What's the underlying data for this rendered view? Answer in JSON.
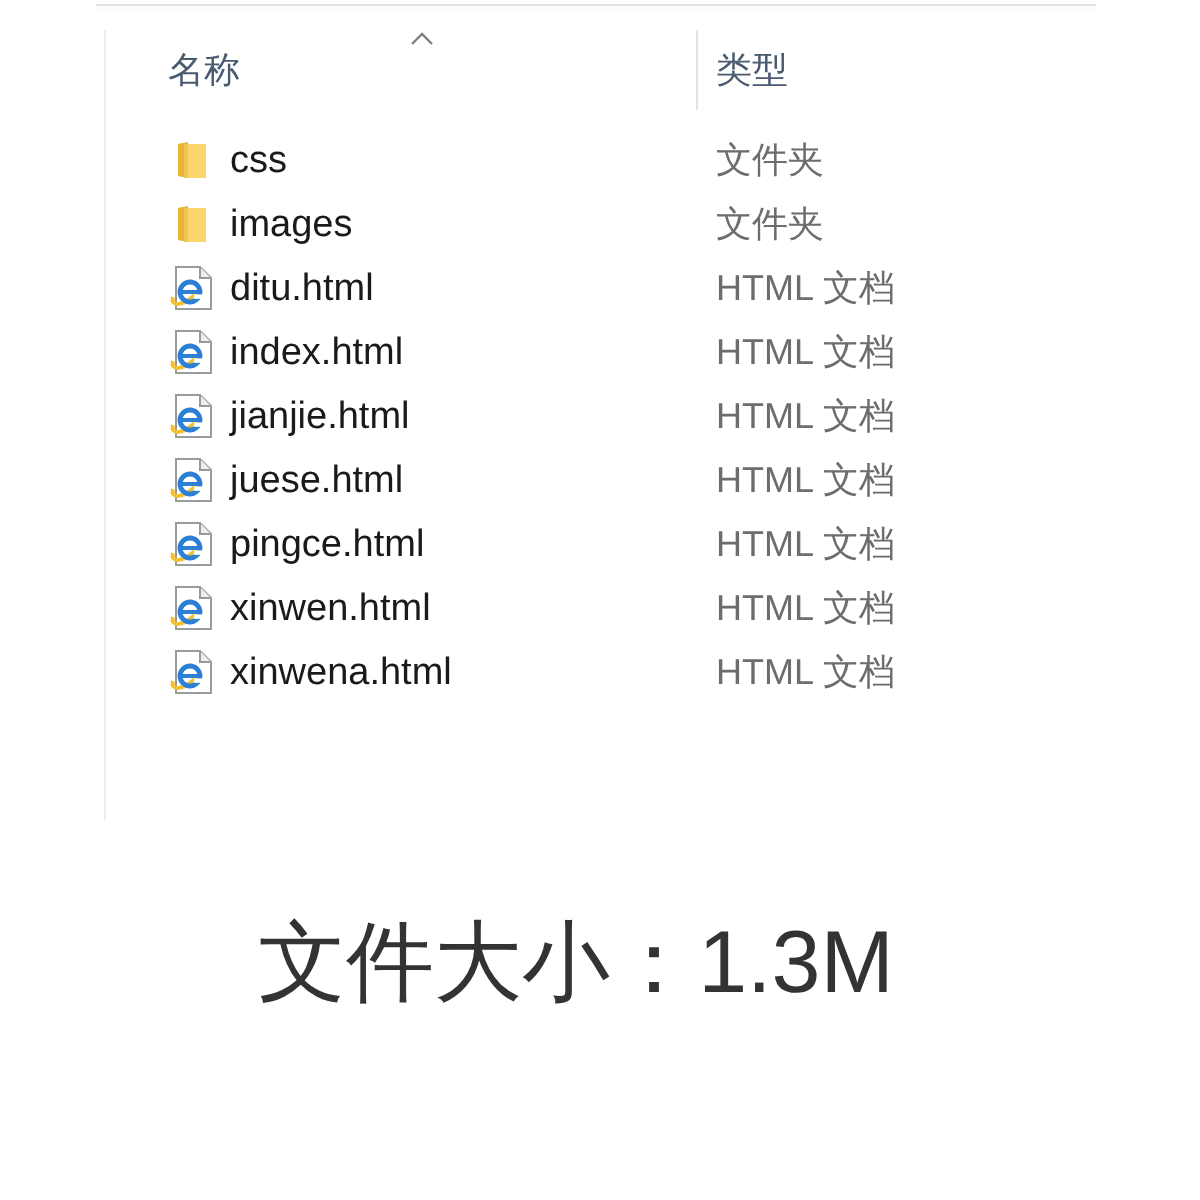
{
  "columns": [
    {
      "label": "名称",
      "sorted": true
    },
    {
      "label": "类型",
      "sorted": false
    }
  ],
  "files": [
    {
      "kind": "folder",
      "name": "css",
      "type": "文件夹"
    },
    {
      "kind": "folder",
      "name": "images",
      "type": "文件夹"
    },
    {
      "kind": "html",
      "name": "ditu.html",
      "type": "HTML 文档"
    },
    {
      "kind": "html",
      "name": "index.html",
      "type": "HTML 文档"
    },
    {
      "kind": "html",
      "name": "jianjie.html",
      "type": "HTML 文档"
    },
    {
      "kind": "html",
      "name": "juese.html",
      "type": "HTML 文档"
    },
    {
      "kind": "html",
      "name": "pingce.html",
      "type": "HTML 文档"
    },
    {
      "kind": "html",
      "name": "xinwen.html",
      "type": "HTML 文档"
    },
    {
      "kind": "html",
      "name": "xinwena.html",
      "type": "HTML 文档"
    }
  ],
  "caption": "文件大小：1.3M"
}
